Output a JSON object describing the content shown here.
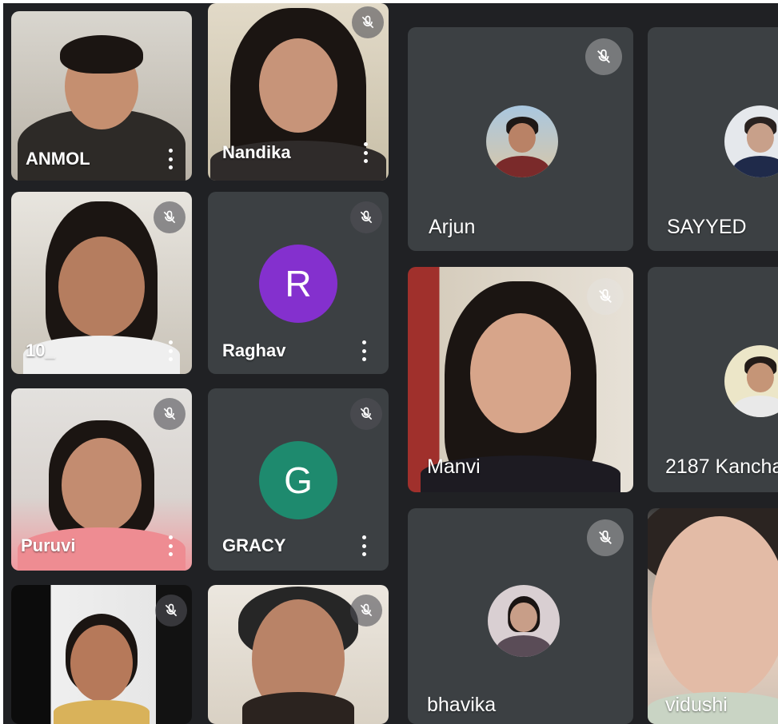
{
  "participants": [
    {
      "name": "ANMOL",
      "type": "video",
      "muted": false,
      "has_menu": true
    },
    {
      "name": "Nandika",
      "type": "video",
      "muted": true,
      "has_menu": true
    },
    {
      "name": "10_",
      "type": "video",
      "muted": true,
      "has_menu": true
    },
    {
      "name": "Raghav",
      "type": "letter-avatar",
      "initial": "R",
      "avatar_color": "#8430ce",
      "muted": true,
      "has_menu": true
    },
    {
      "name": "Puruvi",
      "type": "video",
      "muted": true,
      "has_menu": true
    },
    {
      "name": "GRACY",
      "type": "letter-avatar",
      "initial": "G",
      "avatar_color": "#1e8a6e",
      "muted": true,
      "has_menu": true
    },
    {
      "name": "",
      "type": "video",
      "muted": true,
      "has_menu": false
    },
    {
      "name": "",
      "type": "video",
      "muted": true,
      "has_menu": false
    },
    {
      "name": "Arjun",
      "type": "photo-avatar",
      "muted": true,
      "has_menu": false
    },
    {
      "name": "SAYYED",
      "type": "photo-avatar",
      "muted": false,
      "has_menu": false
    },
    {
      "name": "Manvi",
      "type": "video",
      "muted": true,
      "has_menu": false
    },
    {
      "name": "2187 Kancha",
      "type": "photo-avatar",
      "muted": false,
      "has_menu": false
    },
    {
      "name": "bhavika",
      "type": "photo-avatar",
      "muted": true,
      "has_menu": false
    },
    {
      "name": "vidushi",
      "type": "video",
      "muted": false,
      "has_menu": false
    }
  ],
  "icons": {
    "mute": "mic-off-icon",
    "menu": "more-vert-icon"
  },
  "colors": {
    "background": "#202124",
    "tile": "#3c4043",
    "text": "#ffffff"
  }
}
